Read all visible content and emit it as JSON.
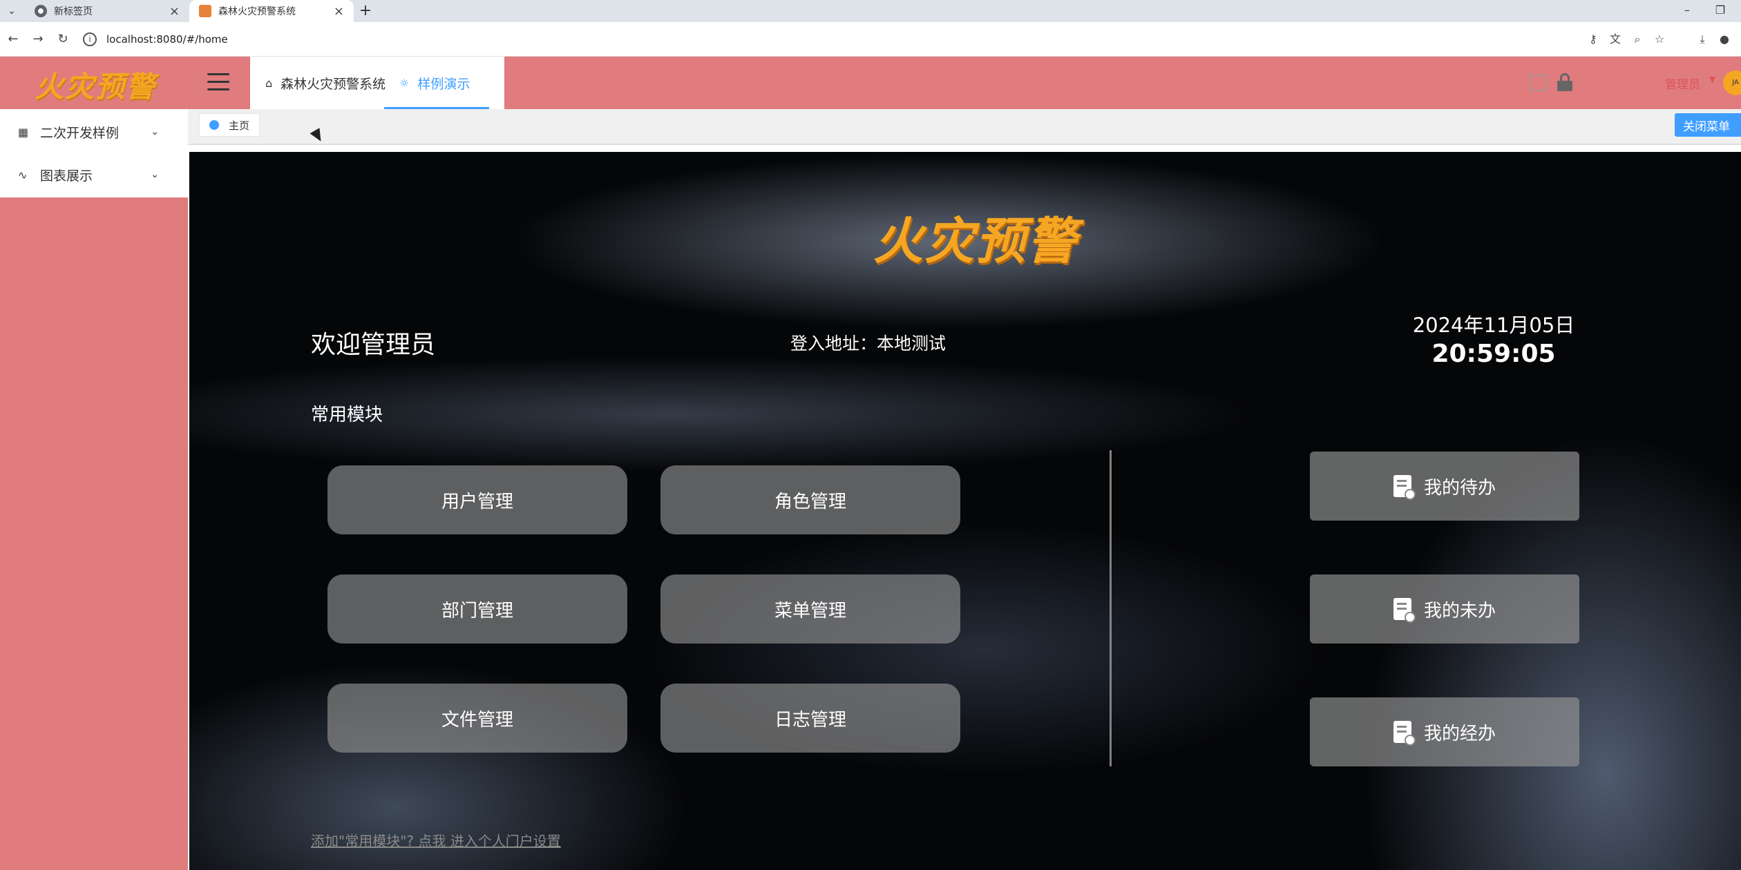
{
  "browser": {
    "tabs": [
      {
        "title": "新标签页"
      },
      {
        "title": "森林火灾预警系统"
      }
    ],
    "url": "localhost:8080/#/home"
  },
  "header": {
    "logo_text": "火灾预警",
    "tabs": [
      {
        "label": "森林火灾预警系统"
      },
      {
        "label": "样例演示"
      }
    ],
    "user_name": "管理员",
    "avatar_text": "JA"
  },
  "sidebar": {
    "items": [
      {
        "label": "二次开发样例"
      },
      {
        "label": "图表展示"
      }
    ]
  },
  "tags": {
    "home_label": "主页",
    "close_menu_label": "关闭菜单"
  },
  "main": {
    "logo_text": "火灾预警",
    "welcome": "欢迎管理员",
    "login_address": "登入地址：本地测试",
    "date": "2024年11月05日",
    "time": "20:59:05",
    "section_title": "常用模块",
    "modules": [
      {
        "label": "用户管理"
      },
      {
        "label": "角色管理"
      },
      {
        "label": "部门管理"
      },
      {
        "label": "菜单管理"
      },
      {
        "label": "文件管理"
      },
      {
        "label": "日志管理"
      }
    ],
    "side_buttons": [
      {
        "label": "我的待办"
      },
      {
        "label": "我的未办"
      },
      {
        "label": "我的经办"
      }
    ],
    "footer_link": "添加\"常用模块\"? 点我 进入个人门户设置"
  }
}
